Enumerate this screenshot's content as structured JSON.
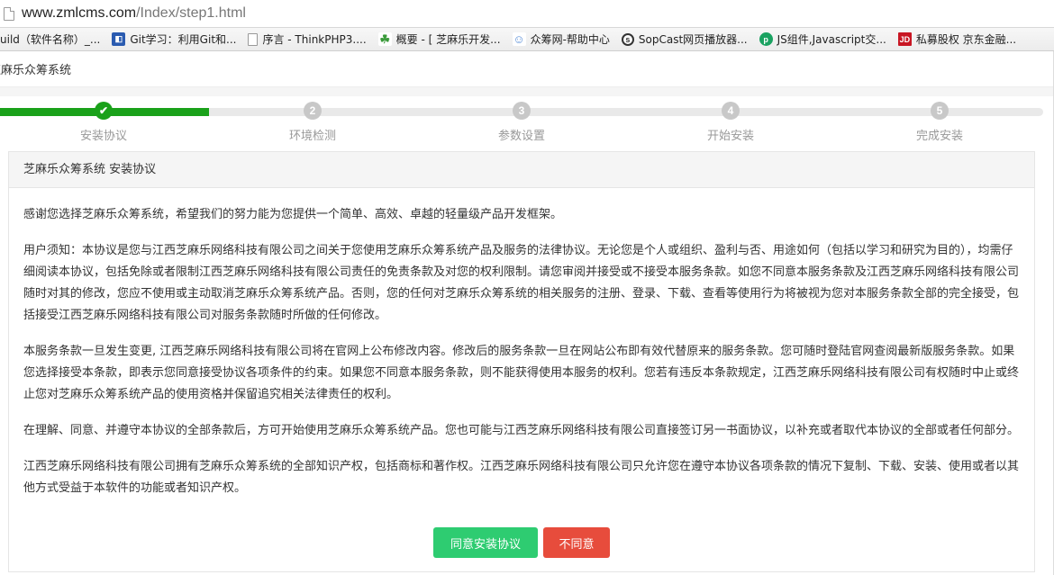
{
  "browser": {
    "url_host": "www.zmlcms.com",
    "url_path": "/Index/step1.html",
    "bookmarks": [
      {
        "label": "uild（软件名称）_...",
        "icon": "none"
      },
      {
        "label": "Git学习：利用Git和...",
        "icon": "blue-square-icon"
      },
      {
        "label": "序言 - ThinkPHP3....",
        "icon": "page-icon"
      },
      {
        "label": "概要 - [ 芝麻乐开发...",
        "icon": "green-leaf-icon"
      },
      {
        "label": "众筹网-帮助中心",
        "icon": "people-icon"
      },
      {
        "label": "SopCast网页播放器...",
        "icon": "sopcast-icon"
      },
      {
        "label": "JS组件,Javascript交...",
        "icon": "p-circle-icon"
      },
      {
        "label": "私募股权 京东金融...",
        "icon": "jd-icon"
      }
    ]
  },
  "app": {
    "title": "芝麻乐众筹系统"
  },
  "steps": {
    "progress_fraction": 0.2,
    "items": [
      {
        "number": "✔",
        "label": "安装协议",
        "done": true
      },
      {
        "number": "2",
        "label": "环境检测",
        "done": false
      },
      {
        "number": "3",
        "label": "参数设置",
        "done": false
      },
      {
        "number": "4",
        "label": "开始安装",
        "done": false
      },
      {
        "number": "5",
        "label": "完成安装",
        "done": false
      }
    ]
  },
  "panel": {
    "heading": "芝麻乐众筹系统 安装协议",
    "paragraphs": [
      "感谢您选择芝麻乐众筹系统，希望我们的努力能为您提供一个简单、高效、卓越的轻量级产品开发框架。",
      "用户须知：本协议是您与江西芝麻乐网络科技有限公司之间关于您使用芝麻乐众筹系统产品及服务的法律协议。无论您是个人或组织、盈利与否、用途如何（包括以学习和研究为目的），均需仔细阅读本协议，包括免除或者限制江西芝麻乐网络科技有限公司责任的免责条款及对您的权利限制。请您审阅并接受或不接受本服务条款。如您不同意本服务条款及江西芝麻乐网络科技有限公司随时对其的修改，您应不使用或主动取消芝麻乐众筹系统产品。否则，您的任何对芝麻乐众筹系统的相关服务的注册、登录、下载、查看等使用行为将被视为您对本服务条款全部的完全接受，包括接受江西芝麻乐网络科技有限公司对服务条款随时所做的任何修改。",
      "本服务条款一旦发生变更, 江西芝麻乐网络科技有限公司将在官网上公布修改内容。修改后的服务条款一旦在网站公布即有效代替原来的服务条款。您可随时登陆官网查阅最新版服务条款。如果您选择接受本条款，即表示您同意接受协议各项条件的约束。如果您不同意本服务条款，则不能获得使用本服务的权利。您若有违反本条款规定，江西芝麻乐网络科技有限公司有权随时中止或终止您对芝麻乐众筹系统产品的使用资格并保留追究相关法律责任的权利。",
      "在理解、同意、并遵守本协议的全部条款后，方可开始使用芝麻乐众筹系统产品。您也可能与江西芝麻乐网络科技有限公司直接签订另一书面协议，以补充或者取代本协议的全部或者任何部分。",
      "江西芝麻乐网络科技有限公司拥有芝麻乐众筹系统的全部知识产权，包括商标和著作权。江西芝麻乐网络科技有限公司只允许您在遵守本协议各项条款的情况下复制、下载、安装、使用或者以其他方式受益于本软件的功能或者知识产权。"
    ],
    "agree_label": "同意安装协议",
    "disagree_label": "不同意"
  },
  "colors": {
    "progress": "#1aa11a",
    "agree": "#2ecc71",
    "disagree": "#e74c3c"
  }
}
